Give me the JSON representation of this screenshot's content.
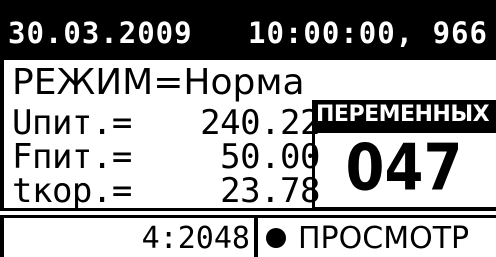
{
  "status_bar": {
    "date": "30.03.2009",
    "time": "10:00:00, 966"
  },
  "mode": {
    "text": "РЕЖИМ=Норма"
  },
  "parameters": [
    {
      "label": "Uпит.=",
      "value": "240.22"
    },
    {
      "label": "Fпит.=",
      "value": "50.00"
    },
    {
      "label": "tкор.=",
      "value": "23.78"
    }
  ],
  "counter": {
    "header": "ПЕРЕМЕННЫХ",
    "value": "047"
  },
  "footer": {
    "record": "4:2048",
    "view_label": "ПРОСМОТР"
  }
}
